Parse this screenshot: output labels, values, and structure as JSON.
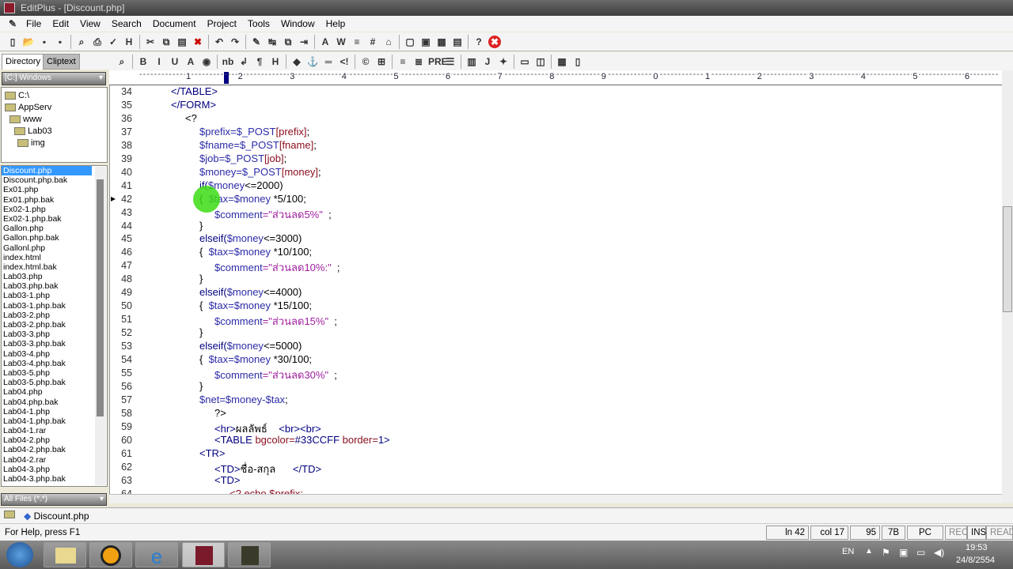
{
  "window": {
    "title": "EditPlus - [Discount.php]"
  },
  "menu": [
    "File",
    "Edit",
    "View",
    "Search",
    "Document",
    "Project",
    "Tools",
    "Window",
    "Help"
  ],
  "toolbar1": [
    "new-file",
    "open",
    "save",
    "save-all",
    "print-preview",
    "print",
    "spell-check",
    "html-preview",
    "cut",
    "copy",
    "paste",
    "delete",
    "undo",
    "redo",
    "highlight",
    "replace",
    "clipboard",
    "indent",
    "font",
    "word-wrap",
    "line-numbers",
    "hex",
    "file-properties",
    "layout-1",
    "layout-2",
    "layout-3",
    "layout-4",
    "help",
    "close"
  ],
  "toolbar2": [
    "html-browser",
    "bold",
    "italic",
    "underline",
    "font",
    "color",
    "nbsp",
    "break",
    "paragraph",
    "heading",
    "image",
    "anchor",
    "hr",
    "comment",
    "special-char",
    "table",
    "center",
    "align",
    "pre",
    "list",
    "form",
    "javascript",
    "script",
    "frame",
    "frame-split",
    "color-picker",
    "window"
  ],
  "sidebar": {
    "tabs": [
      "Directory",
      "Cliptext"
    ],
    "drive": "[C:] Windows",
    "tree": [
      "C:\\",
      "AppServ",
      "www",
      "Lab03",
      "img"
    ],
    "files": [
      "Discount.php",
      "Discount.php.bak",
      "Ex01.php",
      "Ex01.php.bak",
      "Ex02-1.php",
      "Ex02-1.php.bak",
      "Gallon.php",
      "Gallon.php.bak",
      "Gallonl.php",
      "index.html",
      "index.html.bak",
      "Lab03.php",
      "Lab03.php.bak",
      "Lab03-1.php",
      "Lab03-1.php.bak",
      "Lab03-2.php",
      "Lab03-2.php.bak",
      "Lab03-3.php",
      "Lab03-3.php.bak",
      "Lab03-4.php",
      "Lab03-4.php.bak",
      "Lab03-5.php",
      "Lab03-5.php.bak",
      "Lab04.php",
      "Lab04.php.bak",
      "Lab04-1.php",
      "Lab04-1.php.bak",
      "Lab04-1.rar",
      "Lab04-2.php",
      "Lab04-2.php.bak",
      "Lab04-2.rar",
      "Lab04-3.php",
      "Lab04-3.php.bak"
    ],
    "selected_file": "Discount.php",
    "filter": "All Files (*.*)"
  },
  "ruler": [
    "1",
    "2",
    "3",
    "4",
    "5",
    "6",
    "7",
    "8",
    "9",
    "0",
    "1",
    "2",
    "3",
    "4",
    "5",
    "6"
  ],
  "code": [
    {
      "n": "34",
      "i": 0,
      "seg": [
        [
          "</TABLE>",
          "t"
        ]
      ]
    },
    {
      "n": "35",
      "i": 0,
      "seg": [
        [
          "</FORM>",
          "t"
        ]
      ]
    },
    {
      "n": "36",
      "i": 1,
      "seg": [
        [
          "<?",
          "k"
        ]
      ]
    },
    {
      "n": "37",
      "i": 2,
      "seg": [
        [
          "$prefix",
          "v"
        ],
        [
          "=$_POST",
          "v"
        ],
        [
          "[prefix]",
          "r"
        ],
        [
          ";",
          "k"
        ]
      ]
    },
    {
      "n": "38",
      "i": 2,
      "seg": [
        [
          "$fname",
          "v"
        ],
        [
          "=$_POST",
          "v"
        ],
        [
          "[fname]",
          "r"
        ],
        [
          ";",
          "k"
        ]
      ]
    },
    {
      "n": "39",
      "i": 2,
      "seg": [
        [
          "$job",
          "v"
        ],
        [
          "=$_POST",
          "v"
        ],
        [
          "[job]",
          "r"
        ],
        [
          ";",
          "k"
        ]
      ]
    },
    {
      "n": "40",
      "i": 2,
      "seg": [
        [
          "$money",
          "v"
        ],
        [
          "=$_POST",
          "v"
        ],
        [
          "[money]",
          "r"
        ],
        [
          ";",
          "k"
        ]
      ]
    },
    {
      "n": "41",
      "i": 2,
      "seg": [
        [
          "if(",
          "t"
        ],
        [
          "$money",
          "v"
        ],
        [
          "<=2000)",
          "k"
        ]
      ]
    },
    {
      "n": "42",
      "i": 2,
      "seg": [
        [
          "{  ",
          "k"
        ],
        [
          "$tax",
          "v"
        ],
        [
          "=$money",
          "v"
        ],
        [
          " *5/100;",
          "k"
        ]
      ]
    },
    {
      "n": "43",
      "i": 3,
      "seg": [
        [
          "$comment",
          "v"
        ],
        [
          "=\"ส่วนลด5%\"",
          "s"
        ],
        [
          "  ;",
          "k"
        ]
      ]
    },
    {
      "n": "44",
      "i": 2,
      "seg": [
        [
          "}",
          "k"
        ]
      ]
    },
    {
      "n": "45",
      "i": 2,
      "seg": [
        [
          "elseif(",
          "t"
        ],
        [
          "$money",
          "v"
        ],
        [
          "<=3000)",
          "k"
        ]
      ]
    },
    {
      "n": "46",
      "i": 2,
      "seg": [
        [
          "{  ",
          "k"
        ],
        [
          "$tax",
          "v"
        ],
        [
          "=$money",
          "v"
        ],
        [
          " *10/100;",
          "k"
        ]
      ]
    },
    {
      "n": "47",
      "i": 3,
      "seg": [
        [
          "$comment",
          "v"
        ],
        [
          "=\"ส่วนลด10%:\"",
          "s"
        ],
        [
          "  ;",
          "k"
        ]
      ]
    },
    {
      "n": "48",
      "i": 2,
      "seg": [
        [
          "}",
          "k"
        ]
      ]
    },
    {
      "n": "49",
      "i": 2,
      "seg": [
        [
          "elseif(",
          "t"
        ],
        [
          "$money",
          "v"
        ],
        [
          "<=4000)",
          "k"
        ]
      ]
    },
    {
      "n": "50",
      "i": 2,
      "seg": [
        [
          "{  ",
          "k"
        ],
        [
          "$tax",
          "v"
        ],
        [
          "=$money",
          "v"
        ],
        [
          " *15/100;",
          "k"
        ]
      ]
    },
    {
      "n": "51",
      "i": 3,
      "seg": [
        [
          "$comment",
          "v"
        ],
        [
          "=\"ส่วนลด15%\"",
          "s"
        ],
        [
          "  ;",
          "k"
        ]
      ]
    },
    {
      "n": "52",
      "i": 2,
      "seg": [
        [
          "}",
          "k"
        ]
      ]
    },
    {
      "n": "53",
      "i": 2,
      "seg": [
        [
          "elseif(",
          "t"
        ],
        [
          "$money",
          "v"
        ],
        [
          "<=5000)",
          "k"
        ]
      ]
    },
    {
      "n": "54",
      "i": 2,
      "seg": [
        [
          "{  ",
          "k"
        ],
        [
          "$tax",
          "v"
        ],
        [
          "=$money",
          "v"
        ],
        [
          " *30/100;",
          "k"
        ]
      ]
    },
    {
      "n": "55",
      "i": 3,
      "seg": [
        [
          "$comment",
          "v"
        ],
        [
          "=\"ส่วนลด30%\"",
          "s"
        ],
        [
          "  ;",
          "k"
        ]
      ]
    },
    {
      "n": "56",
      "i": 2,
      "seg": [
        [
          "}",
          "k"
        ]
      ]
    },
    {
      "n": "57",
      "i": 2,
      "seg": [
        [
          "$net",
          "v"
        ],
        [
          "=$money-$tax",
          "v"
        ],
        [
          ";",
          "k"
        ]
      ]
    },
    {
      "n": "58",
      "i": 3,
      "seg": [
        [
          "?>",
          "k"
        ]
      ]
    },
    {
      "n": "59",
      "i": 3,
      "seg": [
        [
          "<hr>",
          "t"
        ],
        [
          "ผลลัพธ์    ",
          "k"
        ],
        [
          "<br><br>",
          "t"
        ]
      ]
    },
    {
      "n": "60",
      "i": 3,
      "seg": [
        [
          "<TABLE ",
          "t"
        ],
        [
          "bgcolor=",
          "r"
        ],
        [
          "#33CCFF ",
          "t"
        ],
        [
          "border=",
          "r"
        ],
        [
          "1>",
          "t"
        ]
      ]
    },
    {
      "n": "61",
      "i": 2,
      "seg": [
        [
          "<TR>",
          "t"
        ]
      ]
    },
    {
      "n": "62",
      "i": 3,
      "seg": [
        [
          "<TD>",
          "t"
        ],
        [
          "ชื่อ-สกุล      ",
          "k"
        ],
        [
          "</TD>",
          "t"
        ]
      ]
    },
    {
      "n": "63",
      "i": 3,
      "seg": [
        [
          "<TD>",
          "t"
        ]
      ]
    },
    {
      "n": "64",
      "i": 4,
      "seg": [
        [
          "<? echo $prefix;",
          "r"
        ]
      ]
    }
  ],
  "current_line": "42",
  "doc_tab": "Discount.php",
  "status": {
    "help": "For Help, press F1",
    "line": "ln 42",
    "col": "col 17",
    "lines": "95",
    "size": "7B",
    "format": "PC",
    "rec": "REC",
    "ins": "INS",
    "read": "READ"
  },
  "taskbar": {
    "apps": [
      "start",
      "explorer",
      "aimp",
      "internet-explorer",
      "editplus",
      "app"
    ],
    "lang": "EN",
    "time": "19:53",
    "date": "24/8/2554"
  },
  "colors": {
    "selection": "#3399ff",
    "click_marker": "#3cdc14"
  }
}
